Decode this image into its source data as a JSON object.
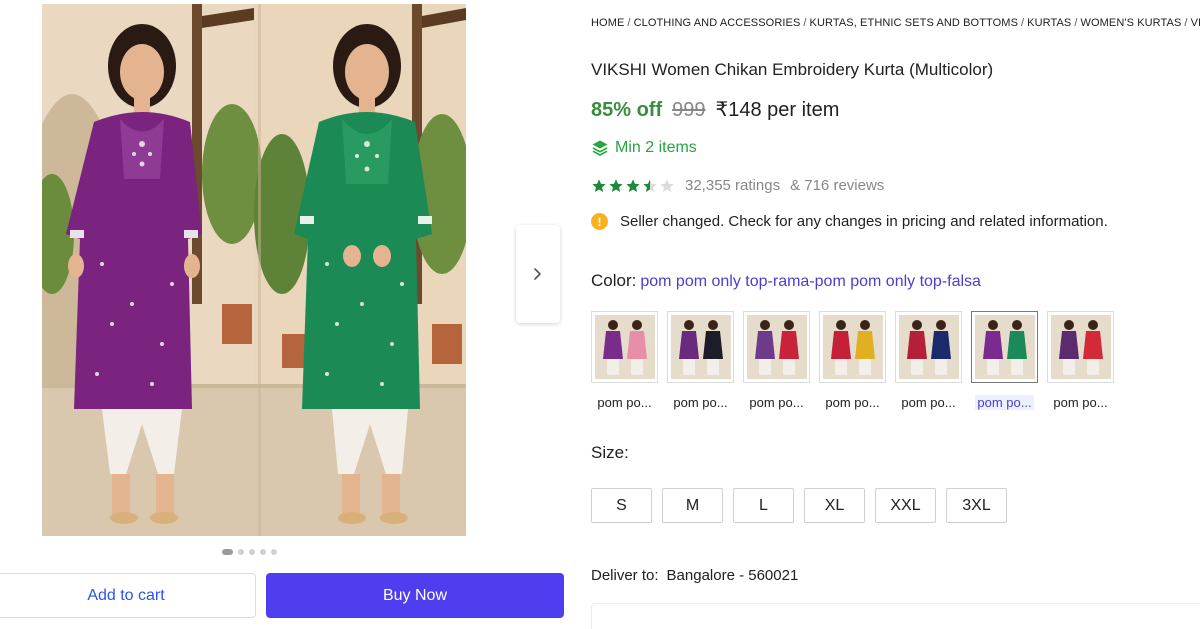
{
  "breadcrumb": [
    "HOME",
    "CLOTHING AND ACCESSORIES",
    "KURTAS, ETHNIC SETS AND BOTTOMS",
    "KURTAS",
    "WOMEN'S KURTAS",
    "VIKSHI"
  ],
  "product": {
    "title": "VIKSHI Women Chikan Embroidery Kurta (Multicolor)",
    "discount": "85% off",
    "mrp": "999",
    "price": "₹148 per item",
    "min_order": "Min 2 items",
    "rating_stars": 3.5,
    "ratings_count": "32,355 ratings",
    "reviews_count": "& 716 reviews",
    "notice": "Seller changed. Check for any changes in pricing and related information."
  },
  "color": {
    "label": "Color:",
    "selected": "pom pom only top-rama-pom pom only top-falsa",
    "options": [
      {
        "label": "pom po...",
        "colors": [
          "#7a2c8a",
          "#e88fa8"
        ],
        "selected": false
      },
      {
        "label": "pom po...",
        "colors": [
          "#6a2a7e",
          "#1d1d2a"
        ],
        "selected": false
      },
      {
        "label": "pom po...",
        "colors": [
          "#6e3a8c",
          "#c8233a"
        ],
        "selected": false
      },
      {
        "label": "pom po...",
        "colors": [
          "#c5203a",
          "#e0b022"
        ],
        "selected": false
      },
      {
        "label": "pom po...",
        "colors": [
          "#b51f3a",
          "#1b2a6a"
        ],
        "selected": false
      },
      {
        "label": "pom po...",
        "colors": [
          "#7b2a8f",
          "#198a58"
        ],
        "selected": true
      },
      {
        "label": "pom po...",
        "colors": [
          "#5c2a6e",
          "#d22a3a"
        ],
        "selected": false
      }
    ]
  },
  "size": {
    "label": "Size:",
    "options": [
      "S",
      "M",
      "L",
      "XL",
      "XXL",
      "3XL"
    ]
  },
  "delivery": {
    "label": "Deliver to:",
    "location": "Bangalore - 560021"
  },
  "actions": {
    "add_to_cart": "Add to cart",
    "buy_now": "Buy Now"
  },
  "gallery": {
    "total_images": 5,
    "active_index": 0
  },
  "icons": {
    "next": "chevron-right-icon",
    "min_order": "layers-icon",
    "notice": "info-icon",
    "star": "star-icon"
  },
  "colors": {
    "accent": "#4f3ef0",
    "discount_green": "#388e3c",
    "star_green": "#1b8b3a",
    "link_purple": "#4a3ed0",
    "info_yellow": "#f9b21f"
  }
}
